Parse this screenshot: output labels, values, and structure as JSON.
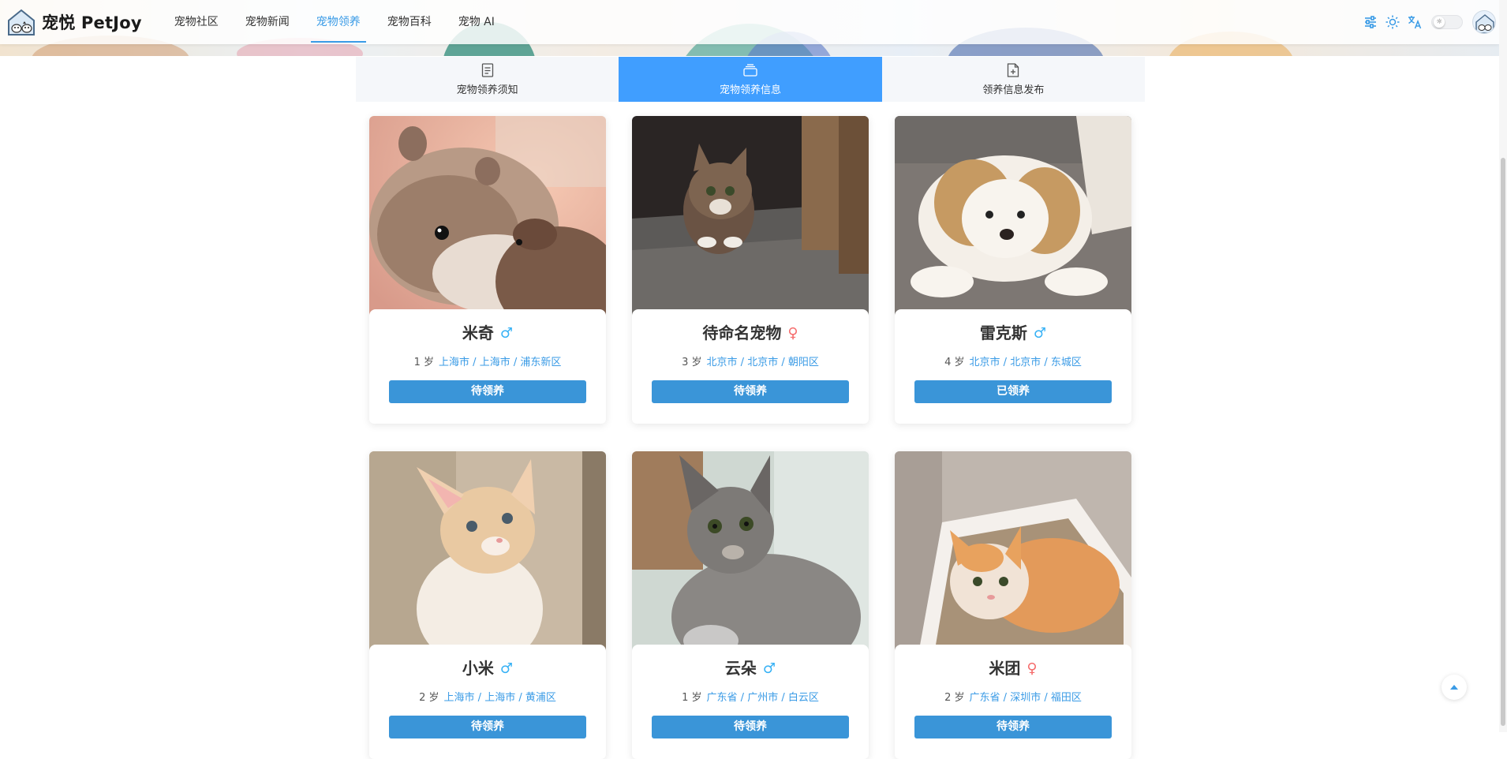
{
  "app": {
    "logo_text": "宠悦 PetJoy"
  },
  "nav": [
    {
      "label": "宠物社区"
    },
    {
      "label": "宠物新闻"
    },
    {
      "label": "宠物领养",
      "active": true
    },
    {
      "label": "宠物百科"
    },
    {
      "label": "宠物 AI"
    }
  ],
  "header_icons": [
    "sliders-icon",
    "sun-icon",
    "translate-icon"
  ],
  "tabs": [
    {
      "label": "宠物领养须知",
      "icon": "document-icon"
    },
    {
      "label": "宠物领养信息",
      "icon": "layers-icon",
      "active": true
    },
    {
      "label": "领养信息发布",
      "icon": "document-add-icon"
    }
  ],
  "pets": [
    {
      "name": "米奇",
      "gender": "male",
      "gender_symbol": "♂",
      "age": "1 岁",
      "location": "上海市 / 上海市 / 浦东新区",
      "status": "待领养",
      "photo": "hamster"
    },
    {
      "name": "待命名宠物",
      "gender": "female",
      "gender_symbol": "♀",
      "age": "3 岁",
      "location": "北京市 / 北京市 / 朝阳区",
      "status": "待领养",
      "photo": "tabby-kitten"
    },
    {
      "name": "雷克斯",
      "gender": "male",
      "gender_symbol": "♂",
      "age": "4 岁",
      "location": "北京市 / 北京市 / 东城区",
      "status": "已领养",
      "photo": "puppy"
    },
    {
      "name": "小米",
      "gender": "male",
      "gender_symbol": "♂",
      "age": "2 岁",
      "location": "上海市 / 上海市 / 黄浦区",
      "status": "待领养",
      "photo": "orange-kitten"
    },
    {
      "name": "云朵",
      "gender": "male",
      "gender_symbol": "♂",
      "age": "1 岁",
      "location": "广东省 / 广州市 / 白云区",
      "status": "待领养",
      "photo": "gray-cat"
    },
    {
      "name": "米团",
      "gender": "female",
      "gender_symbol": "♀",
      "age": "2 岁",
      "location": "广东省 / 深圳市 / 福田区",
      "status": "待领养",
      "photo": "litter-kitten"
    }
  ],
  "colors": {
    "accent": "#409eff",
    "button": "#3a95d8",
    "link": "#3a9be6",
    "male": "#36b1f5",
    "female": "#f56c6c"
  }
}
